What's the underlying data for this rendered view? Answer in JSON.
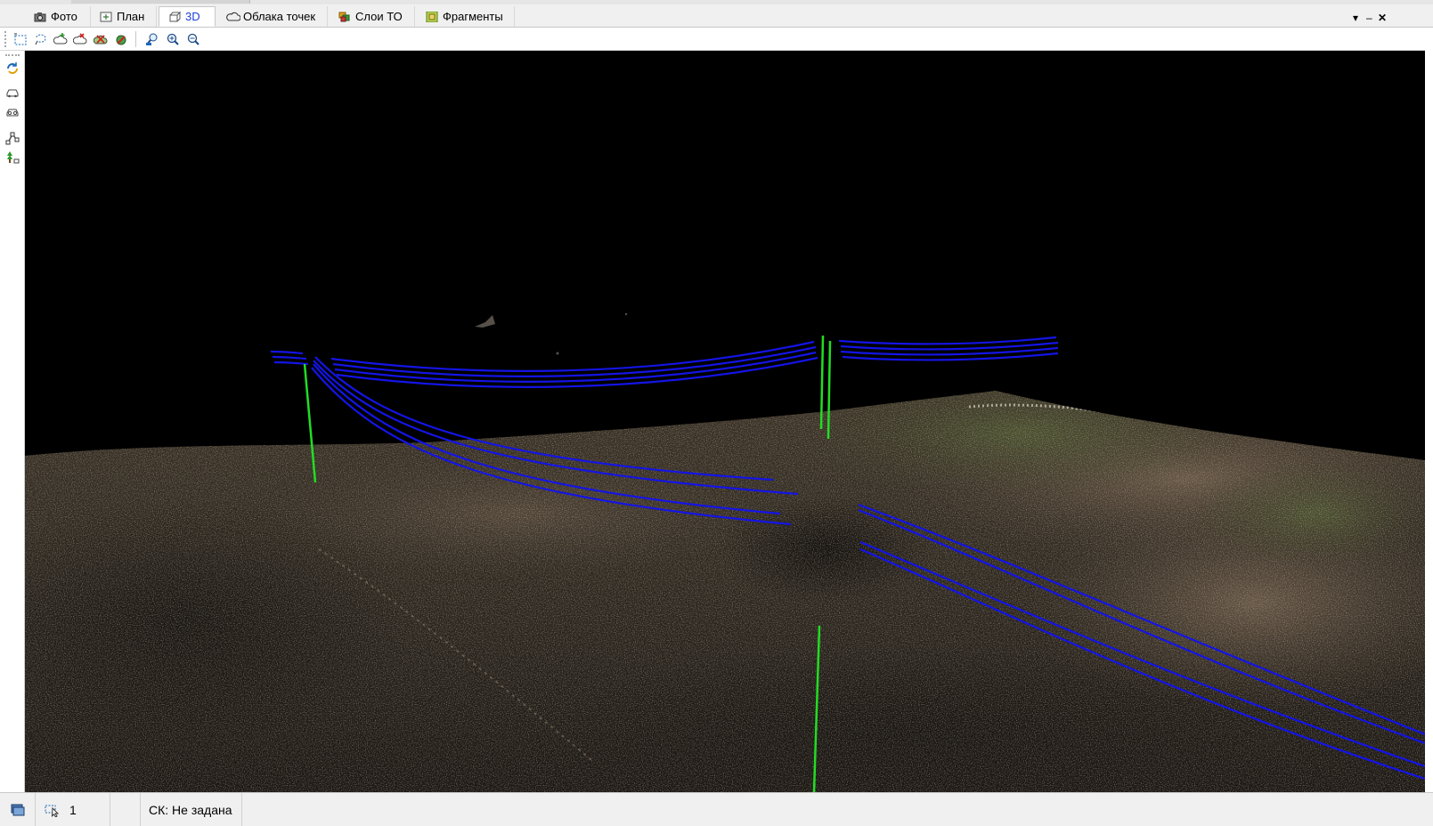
{
  "tabs": [
    {
      "label": "Фото",
      "icon": "camera-icon"
    },
    {
      "label": "План",
      "icon": "plan-icon"
    },
    {
      "label": "3D",
      "icon": "cube-3d-icon",
      "active": true
    },
    {
      "label": "Облака точек",
      "icon": "cloud-icon"
    },
    {
      "label": "Слои ТО",
      "icon": "layers-icon"
    },
    {
      "label": "Фрагменты",
      "icon": "fragments-icon"
    }
  ],
  "window_controls": [
    "dropdown-arrow-icon",
    "minimize-icon",
    "close-icon"
  ],
  "toolbar": {
    "buttons": [
      "select-rect-icon",
      "select-lasso-icon",
      "cloud-add-icon",
      "cloud-remove-icon",
      "cloud-delete-icon",
      "filter-icon",
      "zoom-fit-icon",
      "zoom-in-icon",
      "zoom-out-icon"
    ]
  },
  "left_toolbar": {
    "buttons": [
      "rotate-view-icon",
      "car-front-icon",
      "car-view-icon",
      "polyline-tool-icon",
      "tree-marker-icon"
    ]
  },
  "viewport": {
    "wire_color": "#1414e6",
    "pole_color": "#22dd22",
    "background": "#000000"
  },
  "status": {
    "selection_count": "1",
    "crs_text": "СК: Не задана"
  }
}
